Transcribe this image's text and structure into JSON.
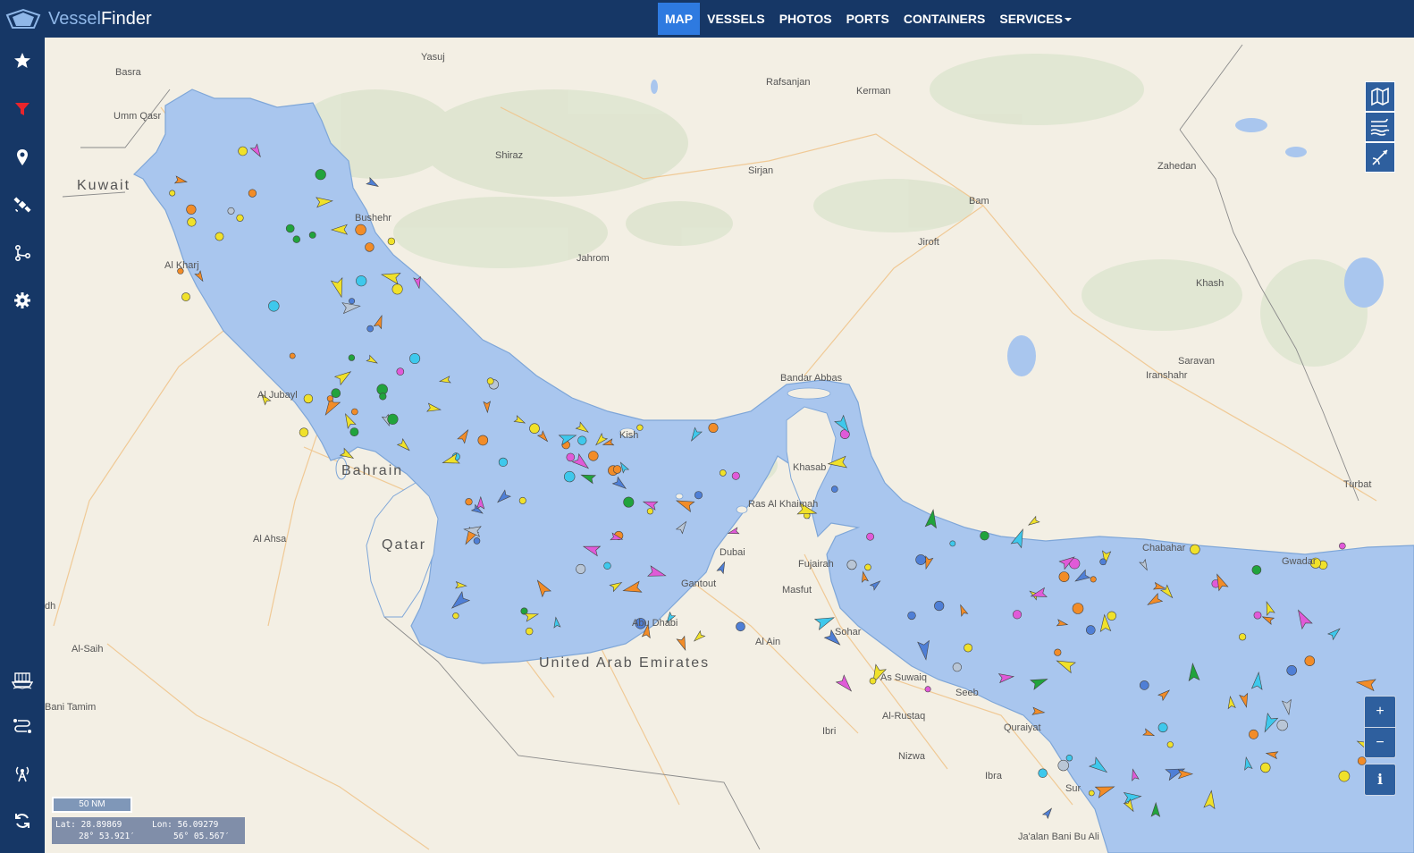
{
  "app": {
    "name_part1": "Vessel",
    "name_part2": "Finder"
  },
  "nav": {
    "items": [
      {
        "label": "MAP",
        "active": true
      },
      {
        "label": "VESSELS",
        "active": false
      },
      {
        "label": "PHOTOS",
        "active": false
      },
      {
        "label": "PORTS",
        "active": false
      },
      {
        "label": "CONTAINERS",
        "active": false
      },
      {
        "label": "SERVICES",
        "active": false,
        "dropdown": true
      }
    ]
  },
  "sidebar": {
    "top_icons": [
      "star-icon",
      "filter-icon",
      "map-pin-icon",
      "satellite-icon",
      "route-icon",
      "gear-icon"
    ],
    "bottom_icons": [
      "container-ship-icon",
      "route-planner-icon",
      "antenna-icon",
      "refresh-icon"
    ]
  },
  "map": {
    "labels": {
      "yasuj": "Yasuj",
      "rafsanjan": "Rafsanjan",
      "kerman": "Kerman",
      "basra": "Basra",
      "umm_qasr": "Umm Qasr",
      "shiraz": "Shiraz",
      "sirjan": "Sirjan",
      "zahedan": "Zahedan",
      "bam": "Bam",
      "bushehr": "Bushehr",
      "jiroft": "Jiroft",
      "jahrom": "Jahrom",
      "al_kharj": "Al Kharj",
      "khash": "Khash",
      "saravan": "Saravan",
      "iranshahr": "Iranshahr",
      "bandar_abbas": "Bandar Abbas",
      "al_jubayl": "Al Jubayl",
      "kish": "Kish",
      "khasab": "Khasab",
      "turbat": "Turbat",
      "ras_al_khaimah": "Ras Al Khaimah",
      "chabahar": "Chabahar",
      "gwadar": "Gwadar",
      "al_ahsa": "Al Ahsa",
      "dubai": "Dubai",
      "fujairah": "Fujairah",
      "gantout": "Gantout",
      "masfut": "Masfut",
      "sohar": "Sohar",
      "abu_dhabi": "Abu Dhabi",
      "al_ain": "Al Ain",
      "al_saih": "Al-Saih",
      "as_suwaiq": "As Suwaiq",
      "seeb": "Seeb",
      "al_rustaq": "Al-Rustaq",
      "quraiyat": "Quraiyat",
      "bani_tamim": "Bani Tamim",
      "ibri": "Ibri",
      "nizwa": "Nizwa",
      "ibra": "Ibra",
      "sur": "Sur",
      "jaalan": "Ja'alan Bani Bu Ali",
      "dh": "dh"
    },
    "countries": {
      "kuwait": "Kuwait",
      "bahrain": "Bahrain",
      "qatar": "Qatar",
      "uae": "United Arab Emirates"
    },
    "right_controls": [
      "map-layers-icon",
      "weather-wind-icon",
      "measure-icon"
    ],
    "zoom_in": "+",
    "zoom_out": "−",
    "info": "i",
    "scale_label": "50 NM",
    "coords": {
      "lat_label": "Lat:",
      "lat_value": "28.89869",
      "lon_label": "Lon:",
      "lon_value": "56.09279",
      "lat_dms": "28° 53.921′",
      "lon_dms": "56° 05.567′"
    },
    "vessel_colors": {
      "cargo": "#f0e12a",
      "tanker": "#f28c28",
      "passenger": "#4f7fd6",
      "tug": "#21a33c",
      "high_speed": "#e05ad8",
      "unknown": "#b9c6d6",
      "pleasure": "#ee3a3a",
      "other": "#3ec8ec"
    }
  }
}
